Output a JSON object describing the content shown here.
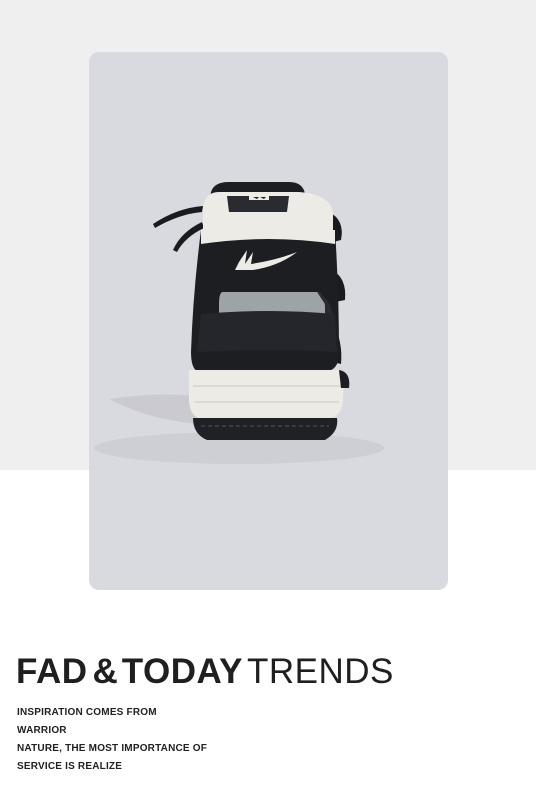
{
  "product_image": {
    "subject": "high-top sneaker, rear view",
    "colors": {
      "background_band": "#efefef",
      "card": "#d9dadf",
      "upper": "#1d1e22",
      "sole": "#ecebe6",
      "reflective_panel": "#9ea3a8"
    },
    "icons": [
      "brand-logo",
      "shoelace"
    ]
  },
  "headline": {
    "part1": "FAD",
    "separator": "&",
    "part2": "TODAY",
    "part3": "TRENDS"
  },
  "tagline": {
    "lines": [
      "INSPIRATION COMES FROM",
      "WARRIOR",
      "NATURE, THE MOST IMPORTANCE OF",
      "SERVICE IS REALIZE"
    ]
  }
}
